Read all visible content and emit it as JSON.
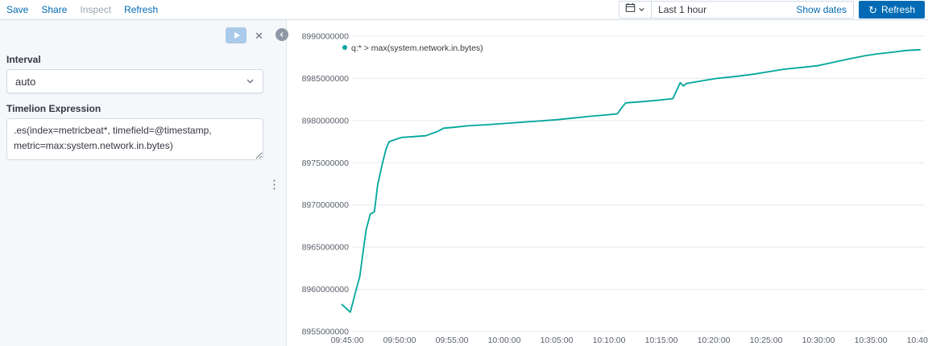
{
  "top_bar": {
    "links": [
      {
        "label": "Save"
      },
      {
        "label": "Share"
      },
      {
        "label": "Inspect",
        "disabled": true
      },
      {
        "label": "Refresh"
      }
    ],
    "date_picker": {
      "value": "Last 1 hour",
      "show_dates": "Show dates"
    },
    "refresh_button": {
      "label": "Refresh"
    }
  },
  "sidebar": {
    "interval_label": "Interval",
    "interval_value": "auto",
    "expression_label": "Timelion Expression",
    "expression_value": ".es(index=metricbeat*, timefield=@timestamp,\nmetric=max:system.network.in.bytes)"
  },
  "chart_data": {
    "type": "line",
    "title": "",
    "legend": "q:* > max(system.network.in.bytes)",
    "legend_position": "top-left",
    "line_color": "#00A69B",
    "grid": "horizontal",
    "xlabel": "",
    "ylabel": "",
    "x_ticks": [
      "09:45:00",
      "09:50:00",
      "09:55:00",
      "10:00:00",
      "10:05:00",
      "10:10:00",
      "10:15:00",
      "10:20:00",
      "10:25:00",
      "10:30:00",
      "10:35:00",
      "10:40:00"
    ],
    "x_tick_minutes": [
      0,
      5,
      10,
      15,
      20,
      25,
      30,
      35,
      40,
      45,
      50,
      55
    ],
    "x_unit": "minutes after 09:45:00",
    "y_ticks": [
      8990000000,
      8985000000,
      8980000000,
      8975000000,
      8970000000,
      8965000000,
      8960000000,
      8955000000
    ],
    "y_domain": [
      8955000000,
      8990000000
    ],
    "points": [
      [
        -0.5,
        8958200000
      ],
      [
        0.3,
        8957300000
      ],
      [
        0.8,
        8959700000
      ],
      [
        1.2,
        8961500000
      ],
      [
        1.8,
        8967000000
      ],
      [
        2.2,
        8968900000
      ],
      [
        2.6,
        8969200000
      ],
      [
        2.9,
        8972300000
      ],
      [
        3.3,
        8974600000
      ],
      [
        3.7,
        8976600000
      ],
      [
        4.0,
        8977500000
      ],
      [
        4.7,
        8977800000
      ],
      [
        5.2,
        8978000000
      ],
      [
        6.3,
        8978100000
      ],
      [
        7.5,
        8978200000
      ],
      [
        8.6,
        8978700000
      ],
      [
        9.2,
        8979100000
      ],
      [
        10.2,
        8979200000
      ],
      [
        11.7,
        8979400000
      ],
      [
        13.2,
        8979500000
      ],
      [
        15.5,
        8979700000
      ],
      [
        17.8,
        8979900000
      ],
      [
        20.0,
        8980100000
      ],
      [
        21.6,
        8980300000
      ],
      [
        23.1,
        8980500000
      ],
      [
        25.0,
        8980700000
      ],
      [
        25.8,
        8980800000
      ],
      [
        26.2,
        8981500000
      ],
      [
        26.6,
        8982100000
      ],
      [
        27.7,
        8982200000
      ],
      [
        29.6,
        8982400000
      ],
      [
        31.1,
        8982600000
      ],
      [
        31.5,
        8983700000
      ],
      [
        31.8,
        8984500000
      ],
      [
        32.1,
        8984100000
      ],
      [
        32.4,
        8984400000
      ],
      [
        33.8,
        8984700000
      ],
      [
        35.3,
        8985000000
      ],
      [
        36.9,
        8985200000
      ],
      [
        38.8,
        8985500000
      ],
      [
        40.3,
        8985800000
      ],
      [
        41.8,
        8986100000
      ],
      [
        43.4,
        8986300000
      ],
      [
        44.9,
        8986500000
      ],
      [
        46.4,
        8986900000
      ],
      [
        47.9,
        8987300000
      ],
      [
        49.5,
        8987700000
      ],
      [
        50.6,
        8987900000
      ],
      [
        52.1,
        8988100000
      ],
      [
        53.3,
        8988300000
      ],
      [
        54.7,
        8988400000
      ]
    ]
  },
  "colors": {
    "primary": "#006BB4",
    "series": "#00A69B",
    "panel_bg": "#f5f7fa",
    "border": "#d3dae6"
  }
}
